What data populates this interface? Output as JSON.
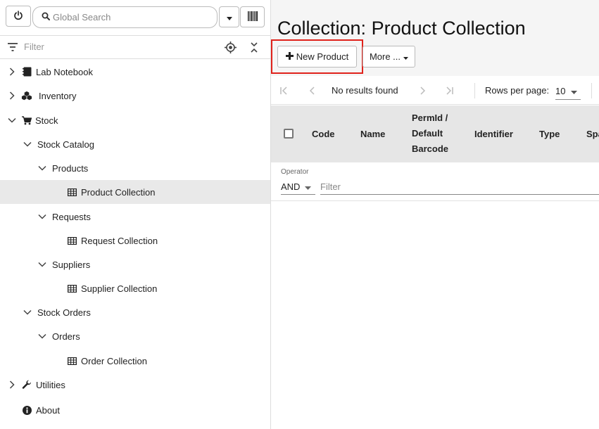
{
  "search": {
    "placeholder": "Global Search"
  },
  "tree_filter": {
    "placeholder": "Filter"
  },
  "tree": [
    {
      "label": "Lab Notebook",
      "chevron": "right",
      "icon": "notebook"
    },
    {
      "label": "Inventory",
      "chevron": "right",
      "icon": "cubes"
    },
    {
      "label": "Stock",
      "chevron": "down",
      "icon": "cart"
    },
    {
      "label": "Stock Catalog",
      "chevron": "down",
      "icon": ""
    },
    {
      "label": "Products",
      "chevron": "down",
      "icon": ""
    },
    {
      "label": "Product Collection",
      "chevron": "",
      "icon": "table",
      "selected": true
    },
    {
      "label": "Requests",
      "chevron": "down",
      "icon": ""
    },
    {
      "label": "Request Collection",
      "chevron": "",
      "icon": "table"
    },
    {
      "label": "Suppliers",
      "chevron": "down",
      "icon": ""
    },
    {
      "label": "Supplier Collection",
      "chevron": "",
      "icon": "table"
    },
    {
      "label": "Stock Orders",
      "chevron": "down",
      "icon": ""
    },
    {
      "label": "Orders",
      "chevron": "down",
      "icon": ""
    },
    {
      "label": "Order Collection",
      "chevron": "",
      "icon": "table"
    },
    {
      "label": "Utilities",
      "chevron": "right",
      "icon": "wrench"
    },
    {
      "label": "About",
      "chevron": "",
      "icon": "info"
    }
  ],
  "main": {
    "title": "Collection: Product Collection",
    "new_button": "New Product",
    "more_button": "More ..."
  },
  "pager": {
    "status": "No results found",
    "rows_label": "Rows per page:",
    "rows_value": "10"
  },
  "table": {
    "columns": [
      "Code",
      "Name",
      "PermId /",
      "Default",
      "Barcode",
      "Identifier",
      "Type",
      "Spa"
    ]
  },
  "filter_row": {
    "operator_label": "Operator",
    "operator_value": "AND",
    "filter_placeholder": "Filter"
  },
  "colors": {
    "highlight": "#e0231c",
    "selected_row": "#e9e9e9",
    "header_bg": "#e6e6e6"
  }
}
